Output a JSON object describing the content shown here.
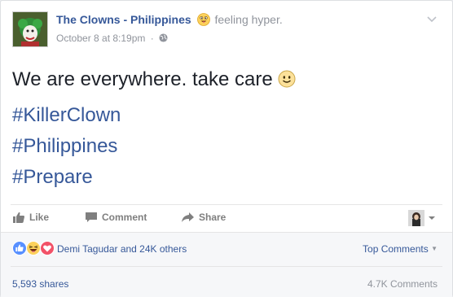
{
  "post": {
    "page_name": "The Clowns - Philippines",
    "feeling": "feeling hyper.",
    "timestamp": "October 8 at 8:19pm",
    "meta_separator": "·",
    "text": "We are everywhere. take care",
    "hashtags": [
      "#KillerClown",
      "#Philippines",
      "#Prepare"
    ]
  },
  "actions": {
    "like": "Like",
    "comment": "Comment",
    "share": "Share"
  },
  "footer": {
    "reactions_text": "Demi Tagudar and 24K others",
    "top_comments": "Top Comments",
    "shares": "5,593 shares",
    "comments_count": "4.7K Comments"
  },
  "icons": {
    "avatar": "clown-avatar",
    "feeling": "crazy-face-emoji",
    "privacy": "globe-icon",
    "menu": "chevron-down-icon",
    "smiley": "smiley-emoji",
    "reactions": [
      "like-reaction-icon",
      "haha-reaction-icon",
      "love-reaction-icon"
    ]
  },
  "colors": {
    "link": "#365899",
    "meta": "#90949c",
    "text": "#1d2129",
    "like_blue": "#5890ff",
    "love_red": "#f25268",
    "haha_yellow": "#fcd15b"
  }
}
